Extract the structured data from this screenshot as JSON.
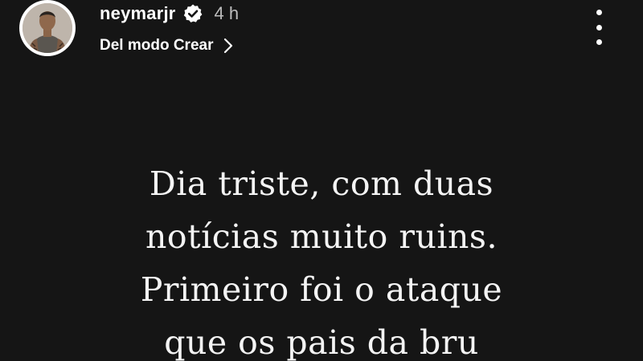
{
  "header": {
    "username": "neymarjr",
    "timestamp": "4 h",
    "subtitle": "Del modo Crear",
    "icons": {
      "verified": "verified-badge-icon",
      "chevron": "chevron-right-icon",
      "more": "more-options-icon"
    }
  },
  "story": {
    "lines": [
      "Dia triste, com duas",
      "notícias muito ruins.",
      "Primeiro foi o ataque",
      "que os pais da bru"
    ]
  },
  "colors": {
    "background": "#151515",
    "text": "#ffffff",
    "muted": "#bdbdbd"
  }
}
